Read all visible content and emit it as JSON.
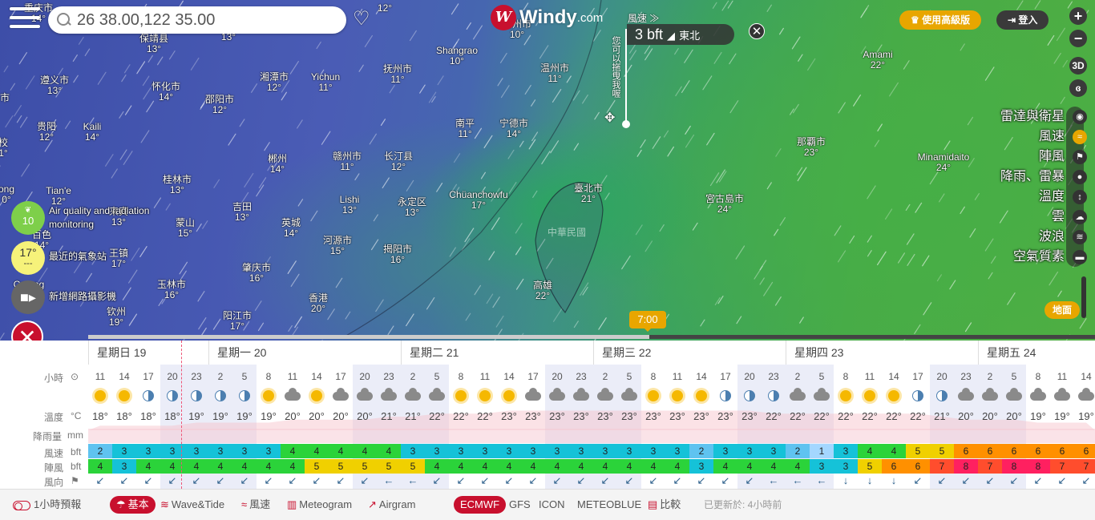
{
  "search": {
    "value": "26 38.00,122 35.00"
  },
  "logo": {
    "text": "Windy",
    "domain": ".com"
  },
  "header": {
    "premium_label": "使用高級版",
    "login_label": "登入"
  },
  "picker": {
    "title": "風速 ≫",
    "value": "3 bft",
    "direction": "東北",
    "hint": "您可以拖曳我喔",
    "close": "✕"
  },
  "map_controls": {
    "zoom_in": "+",
    "zoom_out": "−",
    "threed": "3D"
  },
  "layers": [
    {
      "label": "雷達與衛星",
      "icon": "globe-icon",
      "glyph": "◉",
      "active": false
    },
    {
      "label": "風速",
      "icon": "wind-icon",
      "glyph": "≈",
      "active": true
    },
    {
      "label": "陣風",
      "icon": "flag-icon",
      "glyph": "⚑",
      "active": false
    },
    {
      "label": "降雨、雷暴",
      "icon": "drop-icon",
      "glyph": "●",
      "active": false
    },
    {
      "label": "溫度",
      "icon": "thermometer-icon",
      "glyph": "↕",
      "active": false
    },
    {
      "label": "雲",
      "icon": "cloud-icon",
      "glyph": "☁",
      "active": false
    },
    {
      "label": "波浪",
      "icon": "waves-icon",
      "glyph": "≋",
      "active": false
    },
    {
      "label": "空氣質素",
      "icon": "car-icon",
      "glyph": "▬",
      "active": false
    }
  ],
  "ground_label": "地面",
  "left_widgets": {
    "aqi": {
      "value": "10",
      "label_line1": "Air quality and radiation",
      "label_line2": "monitoring"
    },
    "temp": {
      "value": "17°",
      "sub": "---",
      "label": "最近的氣象站"
    },
    "cam": {
      "label": "新增網路攝影機"
    }
  },
  "time_badge": "7:00",
  "cities": [
    {
      "name": "重庆市",
      "temp": "14°"
    },
    {
      "name": "",
      "temp": "12°"
    },
    {
      "name": "",
      "temp": "13°"
    },
    {
      "name": "保靖县",
      "temp": "13°"
    },
    {
      "name": "遵义市",
      "temp": "13°"
    },
    {
      "name": "怀化市",
      "temp": "14°"
    },
    {
      "name": "湘潭市",
      "temp": "12°"
    },
    {
      "name": "Yichun",
      "temp": "11°"
    },
    {
      "name": "邵阳市",
      "temp": "12°"
    },
    {
      "name": "抚州市",
      "temp": "11°"
    },
    {
      "name": "Shangrao",
      "temp": "10°"
    },
    {
      "name": "温州市",
      "temp": "11°"
    },
    {
      "name": "台州市",
      "temp": "10°"
    },
    {
      "name": "贵阳",
      "temp": "12°"
    },
    {
      "name": "Kaili",
      "temp": "14°"
    },
    {
      "name": "南平",
      "temp": "11°"
    },
    {
      "name": "宁德市",
      "temp": "14°"
    },
    {
      "name": "赣州市",
      "temp": "11°"
    },
    {
      "name": "长汀县",
      "temp": "12°"
    },
    {
      "name": "郴州",
      "temp": "14°"
    },
    {
      "name": "桂林市",
      "temp": "13°"
    },
    {
      "name": "Tian'e",
      "temp": "12°"
    },
    {
      "name": "Lishi",
      "temp": "13°"
    },
    {
      "name": "永定区",
      "temp": "13°"
    },
    {
      "name": "Chüanchowfu",
      "temp": "17°"
    },
    {
      "name": "臺北市",
      "temp": "21°"
    },
    {
      "name": "宮古島市",
      "temp": "24°"
    },
    {
      "name": "吉田",
      "temp": "13°"
    },
    {
      "name": "蒙山",
      "temp": "15°"
    },
    {
      "name": "英城",
      "temp": "14°"
    },
    {
      "name": "百色",
      "temp": "14°"
    },
    {
      "name": "河源市",
      "temp": "15°"
    },
    {
      "name": "揭阳市",
      "temp": "16°"
    },
    {
      "name": "高雄",
      "temp": "22°"
    },
    {
      "name": "肇庆市",
      "temp": "16°"
    },
    {
      "name": "香港",
      "temp": "20°"
    },
    {
      "name": "玉林市",
      "temp": "16°"
    },
    {
      "name": "阳江市",
      "temp": "17°"
    },
    {
      "name": "钦州",
      "temp": "19°"
    },
    {
      "name": "Amami",
      "temp": "22°"
    },
    {
      "name": "那覇市",
      "temp": "23°"
    },
    {
      "name": "Minamidaito",
      "temp": "24°"
    },
    {
      "name": "王镇",
      "temp": "17°"
    },
    {
      "name": "来宾",
      "temp": "13°"
    },
    {
      "name": "校",
      "temp": "1°"
    },
    {
      "name": "ong",
      "temp": "0°"
    },
    {
      "name": "Ca...ng",
      "temp": ""
    },
    {
      "name": "市",
      "temp": ""
    }
  ],
  "region_label": "中華民國",
  "forecast": {
    "row_labels": {
      "hour": "小時",
      "temp": "溫度",
      "temp_unit": "°C",
      "rain": "降雨量",
      "rain_unit": "mm",
      "wind": "風速",
      "wind_unit": "bft",
      "gust": "陣風",
      "gust_unit": "bft",
      "dir": "風向"
    },
    "days": [
      "星期日 19",
      "星期一 20",
      "星期二 21",
      "星期三 22",
      "星期四 23",
      "星期五 24"
    ],
    "day_columns": [
      0,
      5,
      13,
      21,
      29,
      37
    ],
    "hours": [
      "11",
      "14",
      "17",
      "20",
      "23",
      "2",
      "5",
      "8",
      "11",
      "14",
      "17",
      "20",
      "23",
      "2",
      "5",
      "8",
      "11",
      "14",
      "17",
      "20",
      "23",
      "2",
      "5",
      "8",
      "11",
      "14",
      "17",
      "20",
      "23",
      "2",
      "5",
      "8",
      "11",
      "14",
      "17",
      "20",
      "23",
      "2",
      "5",
      "8",
      "11",
      "14"
    ],
    "icons": [
      "sun",
      "sun",
      "moon",
      "moon",
      "moon",
      "moon",
      "moon",
      "sun",
      "cloud",
      "sun",
      "cloud",
      "cloud",
      "cloud",
      "cloud",
      "cloud",
      "sun",
      "sun",
      "sun",
      "cloud",
      "cloud",
      "cloud",
      "cloud",
      "cloud",
      "sun",
      "sun",
      "sun",
      "moon",
      "moon",
      "moon",
      "cloud",
      "cloud",
      "sun",
      "sun",
      "sun",
      "moon",
      "moon",
      "cloud",
      "cloud",
      "cloud",
      "cloud",
      "cloud",
      "cloud"
    ],
    "temps": [
      "18°",
      "18°",
      "18°",
      "18°",
      "19°",
      "19°",
      "19°",
      "19°",
      "20°",
      "20°",
      "20°",
      "20°",
      "21°",
      "21°",
      "22°",
      "22°",
      "22°",
      "23°",
      "23°",
      "23°",
      "23°",
      "23°",
      "23°",
      "23°",
      "23°",
      "23°",
      "23°",
      "23°",
      "22°",
      "22°",
      "22°",
      "22°",
      "22°",
      "22°",
      "22°",
      "21°",
      "20°",
      "20°",
      "20°",
      "19°",
      "19°",
      "19°"
    ],
    "wind": [
      "2",
      "3",
      "3",
      "3",
      "3",
      "3",
      "3",
      "3",
      "4",
      "4",
      "4",
      "4",
      "4",
      "3",
      "3",
      "3",
      "3",
      "3",
      "3",
      "3",
      "3",
      "3",
      "3",
      "3",
      "3",
      "2",
      "3",
      "3",
      "3",
      "2",
      "1",
      "3",
      "4",
      "4",
      "5",
      "5",
      "6",
      "6",
      "6",
      "6",
      "6",
      "6"
    ],
    "gust": [
      "4",
      "3",
      "4",
      "4",
      "4",
      "4",
      "4",
      "4",
      "4",
      "5",
      "5",
      "5",
      "5",
      "5",
      "4",
      "4",
      "4",
      "4",
      "4",
      "4",
      "4",
      "4",
      "4",
      "4",
      "4",
      "3",
      "4",
      "4",
      "4",
      "4",
      "3",
      "3",
      "5",
      "6",
      "6",
      "7",
      "8",
      "7",
      "8",
      "8",
      "7",
      "7"
    ],
    "dirs": [
      "↙",
      "↙",
      "↙",
      "↙",
      "↙",
      "↙",
      "↙",
      "↙",
      "↙",
      "↙",
      "↙",
      "↙",
      "←",
      "←",
      "↙",
      "↙",
      "↙",
      "↙",
      "↙",
      "↙",
      "↙",
      "↙",
      "↙",
      "↙",
      "↙",
      "↙",
      "↙",
      "↙",
      "←",
      "←",
      "←",
      "↓",
      "↓",
      "↓",
      "↙",
      "↙",
      "↙",
      "↙",
      "↙",
      "↙",
      "↙",
      "↙"
    ]
  },
  "bottom_bar": {
    "hourly_toggle": "1小時預報",
    "tabs": [
      {
        "label": "基本",
        "icon": "umbrella-icon",
        "glyph": "☂",
        "selected": true
      },
      {
        "label": "Wave&Tide",
        "icon": "wave-icon",
        "glyph": "≋",
        "selected": false
      },
      {
        "label": "風速",
        "icon": "wind-icon",
        "glyph": "≈",
        "selected": false
      },
      {
        "label": "Meteogram",
        "icon": "meteogram-icon",
        "glyph": "▥",
        "selected": false
      },
      {
        "label": "Airgram",
        "icon": "airgram-icon",
        "glyph": "↗",
        "selected": false
      }
    ],
    "models": [
      {
        "label": "ECMWF",
        "selected": true
      },
      {
        "label": "GFS",
        "selected": false
      },
      {
        "label": "ICON",
        "selected": false
      },
      {
        "label": "METEOBLUE",
        "selected": false
      },
      {
        "label": "比較",
        "selected": false
      }
    ],
    "last_update": "已更新於: 4小時前"
  },
  "colors": {
    "brand": "#c8102e",
    "premium": "#e8a600",
    "bft1": "#a4d7ff",
    "bft2": "#5fc3f0",
    "bft3": "#15c2d8",
    "bft4": "#2bd33a",
    "bft5": "#f0d000",
    "bft6": "#ff9000",
    "bft7": "#ff4d2d",
    "bft8": "#ff2060"
  }
}
